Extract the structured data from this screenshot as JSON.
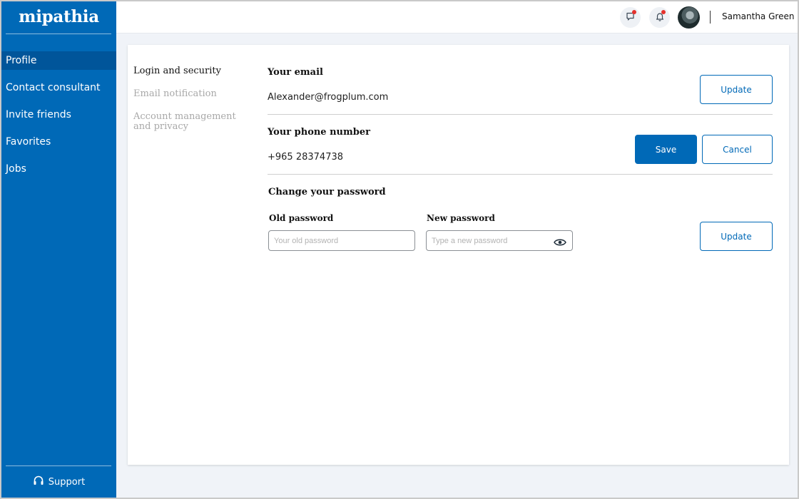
{
  "sidebar": {
    "logo": "mipathia",
    "items": [
      {
        "label": "Profile",
        "active": true
      },
      {
        "label": "Contact consultant"
      },
      {
        "label": "Invite friends"
      },
      {
        "label": "Favorites"
      },
      {
        "label": "Jobs"
      }
    ],
    "support_label": "Support"
  },
  "header": {
    "user_name": "Samantha Green",
    "icons": [
      "chat-icon",
      "bell-icon"
    ]
  },
  "settings_nav": {
    "items": [
      {
        "label": "Login and security",
        "active": true
      },
      {
        "label": "Email notification"
      },
      {
        "label": "Account management and privacy"
      }
    ]
  },
  "email": {
    "title": "Your email",
    "value": "Alexander@frogplum.com",
    "update_label": "Update"
  },
  "phone": {
    "title": "Your phone number",
    "value": "+965 28374738",
    "save_label": "Save",
    "cancel_label": "Cancel"
  },
  "password": {
    "title": "Change your password",
    "old_label": "Old password",
    "old_placeholder": "Your old password",
    "new_label": "New password",
    "new_placeholder": "Type a new password",
    "update_label": "Update"
  },
  "colors": {
    "brand": "#0069b7",
    "notification": "#e5312c"
  }
}
